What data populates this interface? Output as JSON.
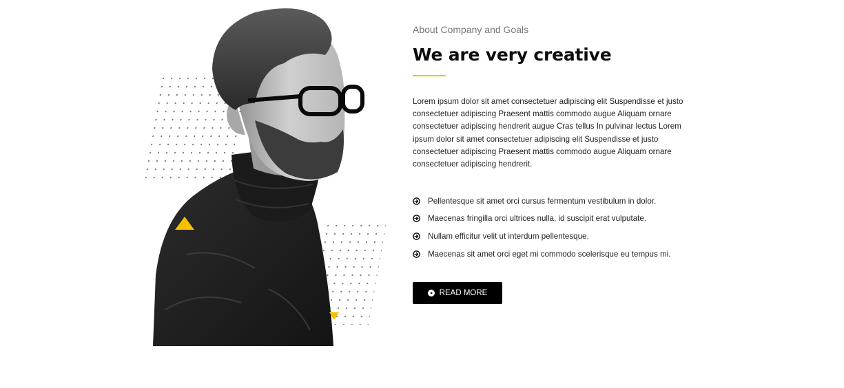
{
  "about": {
    "eyebrow": "About Company and Goals",
    "title": "We are very creative",
    "paragraph": "Lorem ipsum dolor sit amet consectetuer adipiscing elit Suspendisse et justo consectetuer adipiscing Praesent mattis commodo augue Aliquam ornare consectetuer adipiscing hendrerit augue Cras tellus In pulvinar lectus Lorem ipsum dolor sit amet consectetuer adipiscing elit Suspendisse et justo consectetuer adipiscing Praesent mattis commodo augue Aliquam ornare consectetuer adipiscing hendrerit.",
    "bullets": [
      "Pellentesque sit amet orci cursus fermentum vestibulum in dolor.",
      "Maecenas fringilla orci ultrices nulla, id suscipit erat vulputate.",
      "Nullam efficitur velit ut interdum pellentesque.",
      "Maecenas sit amet orci eget mi commodo scelerisque eu tempus mi."
    ],
    "button_label": "READ MORE"
  },
  "icons": {
    "bullet": "arrow-circle-right-icon",
    "button": "play-circle-icon"
  },
  "colors": {
    "accent": "#f5c000",
    "button_bg": "#000000",
    "heading": "#0d0d0d",
    "body_text": "#222222",
    "eyebrow": "#777777"
  }
}
